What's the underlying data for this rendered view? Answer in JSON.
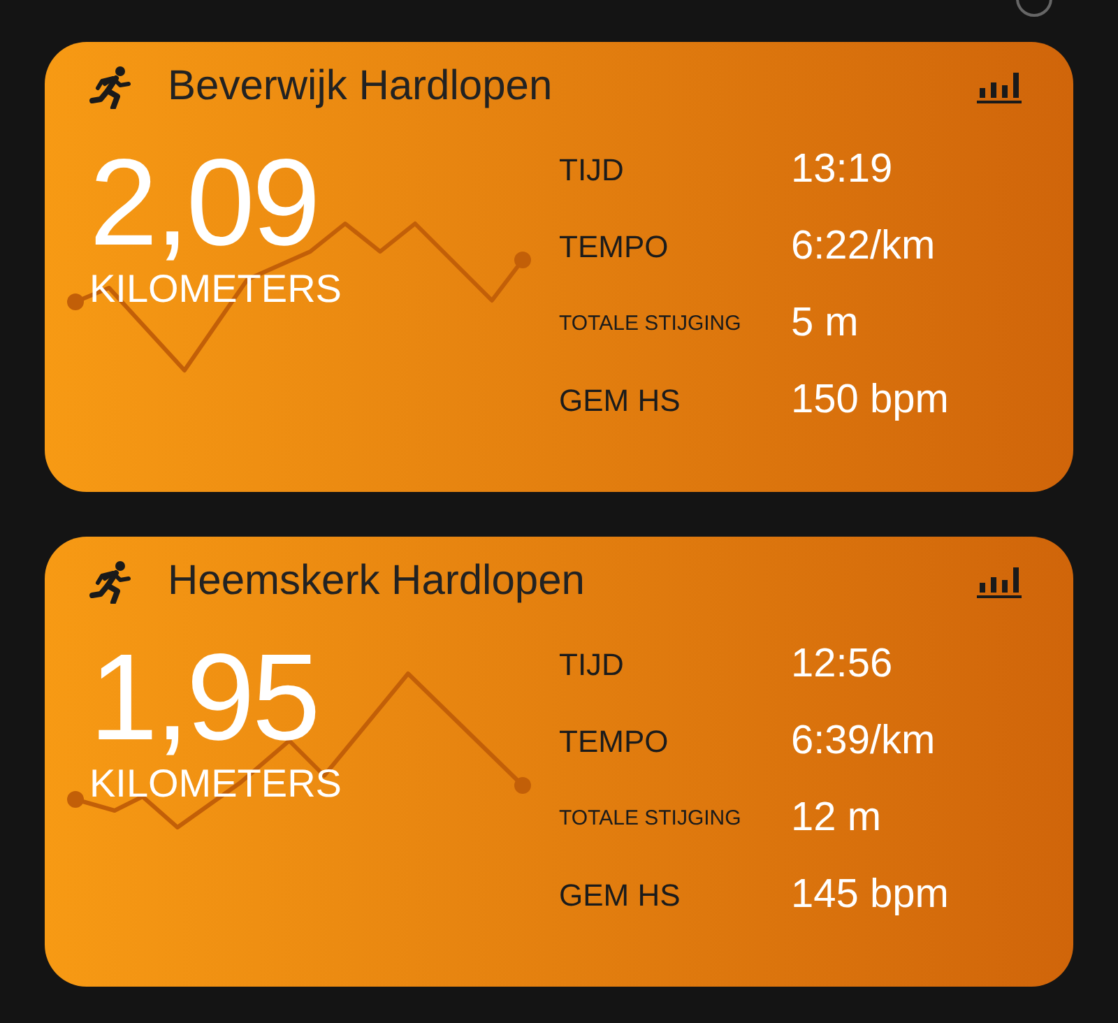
{
  "activities": [
    {
      "title": "Beverwijk Hardlopen",
      "distance": "2,09",
      "unit": "KILOMETERS",
      "stats": [
        {
          "label": "TIJD",
          "value": "13:19",
          "kind": "normal"
        },
        {
          "label": "TEMPO",
          "value": "6:22/km",
          "kind": "normal"
        },
        {
          "label": "TOTALE STIJGING",
          "value": "5 m",
          "kind": "small"
        },
        {
          "label": "GEM HS",
          "value": "150 bpm",
          "kind": "normal"
        }
      ]
    },
    {
      "title": "Heemskerk Hardlopen",
      "distance": "1,95",
      "unit": "KILOMETERS",
      "stats": [
        {
          "label": "TIJD",
          "value": "12:56",
          "kind": "normal"
        },
        {
          "label": "TEMPO",
          "value": "6:39/km",
          "kind": "normal"
        },
        {
          "label": "TOTALE STIJGING",
          "value": "12 m",
          "kind": "small"
        },
        {
          "label": "GEM HS",
          "value": "145 bpm",
          "kind": "normal"
        }
      ]
    }
  ]
}
